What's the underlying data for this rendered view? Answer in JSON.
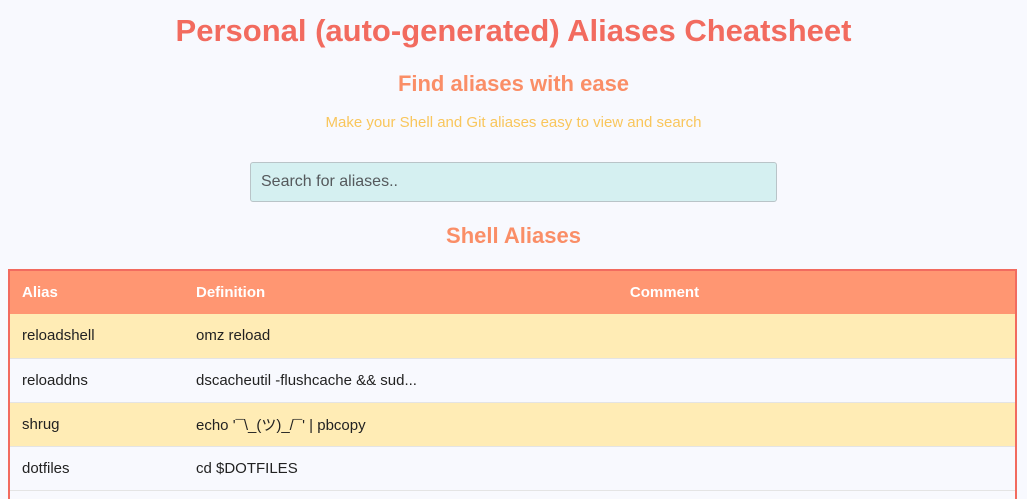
{
  "header": {
    "title": "Personal (auto-generated) Aliases Cheatsheet",
    "subtitle": "Find aliases with ease",
    "tagline": "Make your Shell and Git aliases easy to view and search"
  },
  "search": {
    "placeholder": "Search for aliases..",
    "value": ""
  },
  "shell_section": {
    "title": "Shell Aliases",
    "columns": {
      "alias": "Alias",
      "definition": "Definition",
      "comment": "Comment"
    },
    "rows": [
      {
        "alias": "reloadshell",
        "definition": "omz reload",
        "comment": ""
      },
      {
        "alias": "reloaddns",
        "definition": "dscacheutil -flushcache && sud...",
        "comment": ""
      },
      {
        "alias": "shrug",
        "definition": "echo '¯\\_(ツ)_/¯' | pbcopy",
        "comment": ""
      },
      {
        "alias": "dotfiles",
        "definition": "cd $DOTFILES",
        "comment": ""
      }
    ]
  },
  "colors": {
    "title": "#f26b5f",
    "subtitle": "#fa8e67",
    "tagline": "#f9c65c",
    "table_header": "#ff9672",
    "row_highlight": "#ffecb5",
    "search_bg": "#d5f0f1"
  }
}
